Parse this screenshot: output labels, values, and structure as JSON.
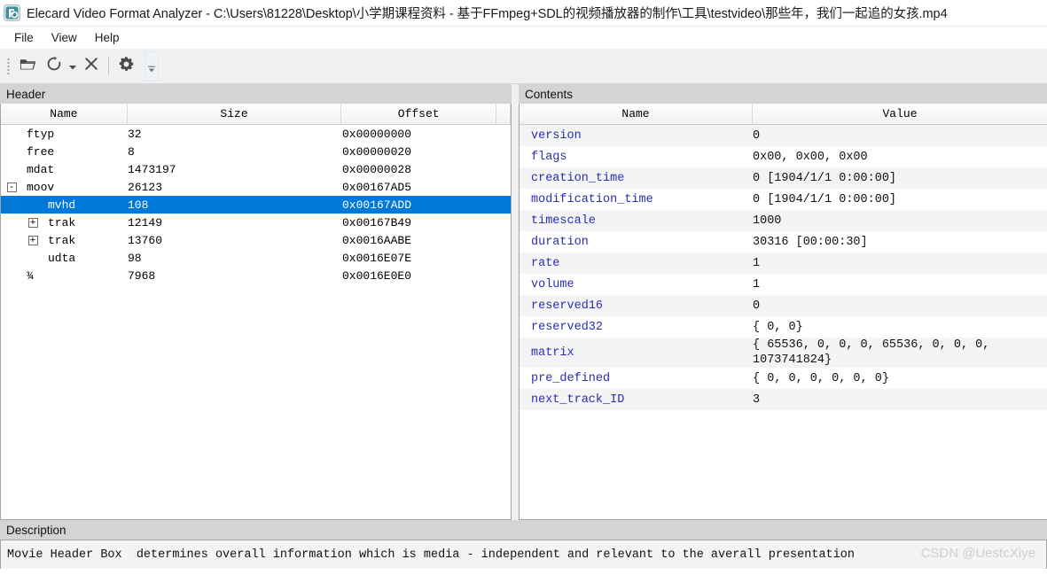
{
  "window": {
    "title": "Elecard Video Format Analyzer - C:\\Users\\81228\\Desktop\\小学期课程资料 - 基于FFmpeg+SDL的视频播放器的制作\\工具\\testvideo\\那些年，我们一起追的女孩.mp4",
    "icon": "app-logo-icon"
  },
  "menubar": {
    "items": [
      {
        "label": "File"
      },
      {
        "label": "View"
      },
      {
        "label": "Help"
      }
    ]
  },
  "toolbar": {
    "buttons": [
      {
        "name": "open-file-button",
        "icon": "folder-open-icon"
      },
      {
        "name": "refresh-button",
        "icon": "refresh-icon"
      },
      {
        "name": "refresh-dropdown-button",
        "icon": "caret-down-icon"
      },
      {
        "name": "close-file-button",
        "icon": "close-x-icon"
      },
      {
        "name": "settings-button",
        "icon": "gear-icon"
      }
    ],
    "overflow": {
      "name": "toolbar-overflow-button",
      "icon": "double-chevron-down-icon"
    }
  },
  "header_panel": {
    "caption": "Header",
    "columns": [
      "Name",
      "Size",
      "Offset"
    ],
    "rows": [
      {
        "expander": "",
        "indent": 0,
        "name": "ftyp",
        "size": "32",
        "offset": "0x00000000",
        "selected": false
      },
      {
        "expander": "",
        "indent": 0,
        "name": "free",
        "size": "8",
        "offset": "0x00000020",
        "selected": false
      },
      {
        "expander": "",
        "indent": 0,
        "name": "mdat",
        "size": "1473197",
        "offset": "0x00000028",
        "selected": false
      },
      {
        "expander": "-",
        "indent": 0,
        "name": "moov",
        "size": "26123",
        "offset": "0x00167AD5",
        "selected": false
      },
      {
        "expander": "",
        "indent": 1,
        "name": "mvhd",
        "size": "108",
        "offset": "0x00167ADD",
        "selected": true
      },
      {
        "expander": "+",
        "indent": 1,
        "name": "trak",
        "size": "12149",
        "offset": "0x00167B49",
        "selected": false
      },
      {
        "expander": "+",
        "indent": 1,
        "name": "trak",
        "size": "13760",
        "offset": "0x0016AABE",
        "selected": false
      },
      {
        "expander": "",
        "indent": 1,
        "name": "udta",
        "size": "98",
        "offset": "0x0016E07E",
        "selected": false
      },
      {
        "expander": "",
        "indent": 0,
        "name": "¾",
        "size": "7968",
        "offset": "0x0016E0E0",
        "selected": false
      }
    ]
  },
  "contents_panel": {
    "caption": "Contents",
    "columns": [
      "Name",
      "Value"
    ],
    "rows": [
      {
        "name": "version",
        "value": "0"
      },
      {
        "name": "flags",
        "value": "0x00, 0x00, 0x00"
      },
      {
        "name": "creation_time",
        "value": "0 [1904/1/1 0:00:00]"
      },
      {
        "name": "modification_time",
        "value": "0 [1904/1/1 0:00:00]"
      },
      {
        "name": "timescale",
        "value": "1000"
      },
      {
        "name": "duration",
        "value": "30316 [00:00:30]"
      },
      {
        "name": "rate",
        "value": "1"
      },
      {
        "name": "volume",
        "value": "1"
      },
      {
        "name": "reserved16",
        "value": "0"
      },
      {
        "name": "reserved32",
        "value": "{ 0, 0}"
      },
      {
        "name": "matrix",
        "value": "{ 65536, 0, 0, 0, 65536, 0, 0, 0,\n1073741824}",
        "tall": true
      },
      {
        "name": "pre_defined",
        "value": "{ 0, 0, 0, 0, 0, 0}"
      },
      {
        "name": "next_track_ID",
        "value": "3"
      }
    ]
  },
  "description_panel": {
    "caption": "Description",
    "text": "Movie Header Box  determines overall information which is media - independent and relevant to the averall presentation",
    "watermark": "CSDN @UestcXiye"
  },
  "colors": {
    "selection": "#0078d7",
    "caption_bar": "#d4d4d4",
    "key_text": "#2b2bb7",
    "toolbar_bg": "#f0f0f0",
    "alt_row": "#f4f4f4"
  }
}
